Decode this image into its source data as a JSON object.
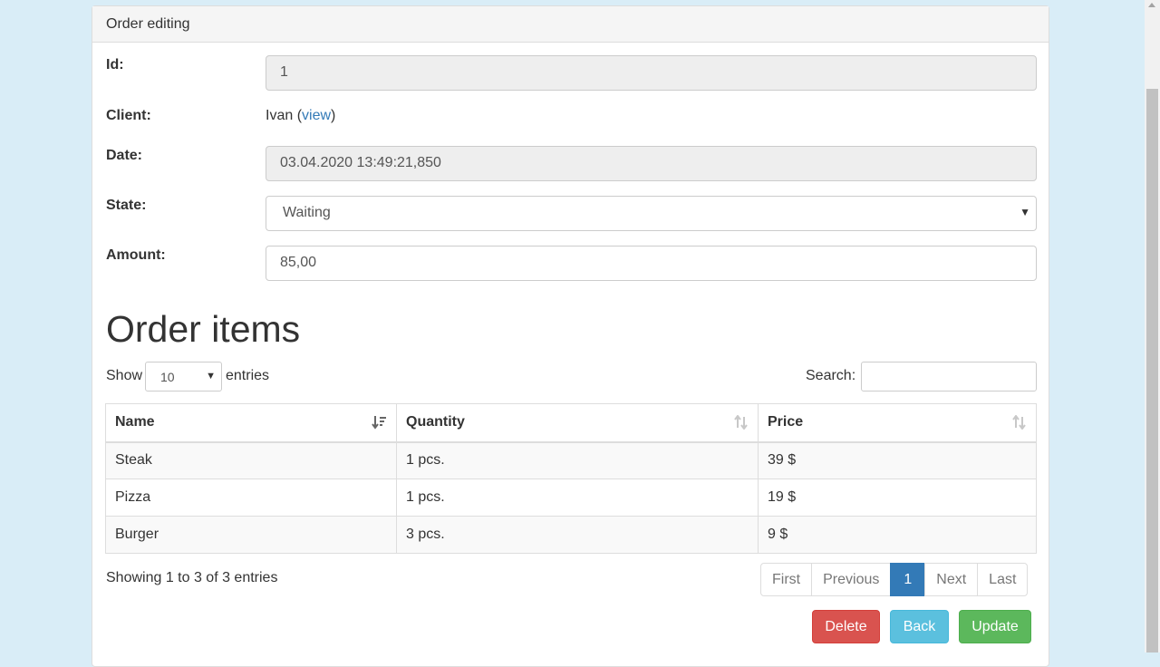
{
  "panel": {
    "heading": "Order editing"
  },
  "form": {
    "id": {
      "label": "Id:",
      "value": "1"
    },
    "client": {
      "label": "Client:",
      "name": "Ivan",
      "open_paren": " (",
      "link": "view",
      "close_paren": ")"
    },
    "date": {
      "label": "Date:",
      "value": "03.04.2020 13:49:21,850"
    },
    "state": {
      "label": "State:",
      "value": "Waiting"
    },
    "amount": {
      "label": "Amount:",
      "value": "85,00"
    }
  },
  "items": {
    "title": "Order items",
    "show_label": "Show",
    "entries_value": "10",
    "entries_label": "entries",
    "search_label": "Search:",
    "columns": [
      "Name",
      "Quantity",
      "Price"
    ],
    "rows": [
      {
        "name": "Steak",
        "quantity": "1 pcs.",
        "price": "39 $"
      },
      {
        "name": "Pizza",
        "quantity": "1 pcs.",
        "price": "19 $"
      },
      {
        "name": "Burger",
        "quantity": "3 pcs.",
        "price": "9 $"
      }
    ],
    "info": "Showing 1 to 3 of 3 entries",
    "pagination": [
      "First",
      "Previous",
      "1",
      "Next",
      "Last"
    ]
  },
  "actions": {
    "delete": "Delete",
    "back": "Back",
    "update": "Update"
  },
  "colors": {
    "primary": "#337ab7",
    "danger": "#d9534f",
    "info": "#5bc0de",
    "success": "#5cb85c",
    "background": "#d9edf7"
  }
}
